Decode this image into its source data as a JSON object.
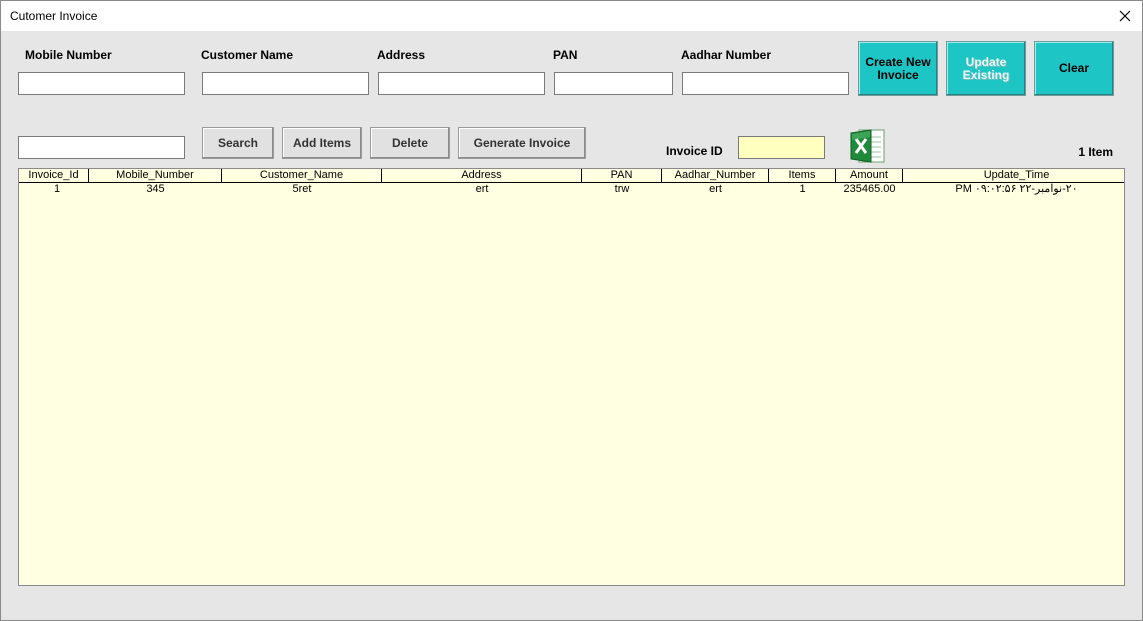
{
  "window": {
    "title": "Cutomer Invoice"
  },
  "form": {
    "mobile_label": "Mobile Number",
    "customer_label": "Customer Name",
    "address_label": "Address",
    "pan_label": "PAN",
    "aadhar_label": "Aadhar Number",
    "mobile_value": "",
    "customer_value": "",
    "address_value": "",
    "pan_value": "",
    "aadhar_value": ""
  },
  "buttons": {
    "create_new": "Create New Invoice",
    "update_existing": "Update Existing",
    "clear": "Clear",
    "search": "Search",
    "add_items": "Add Items",
    "delete": "Delete",
    "generate_invoice": "Generate Invoice"
  },
  "search": {
    "value": ""
  },
  "invoice_id": {
    "label": "Invoice ID",
    "value": ""
  },
  "item_count": "1 Item",
  "excel_icon": "excel-icon",
  "colors": {
    "teal": "#1ec5c5",
    "list_bg": "#ffffe1",
    "invoice_box": "#ffffc0"
  },
  "table": {
    "columns": [
      "Invoice_Id",
      "Mobile_Number",
      "Customer_Name",
      "Address",
      "PAN",
      "Aadhar_Number",
      "Items",
      "Amount",
      "Update_Time"
    ],
    "rows": [
      [
        "1",
        "345",
        "5ret",
        "ert",
        "trw",
        "ert",
        "1",
        "235465.00",
        "۲۰-نوامبر-۲۲ ۰۹:۰۲:۵۶ PM"
      ]
    ]
  }
}
